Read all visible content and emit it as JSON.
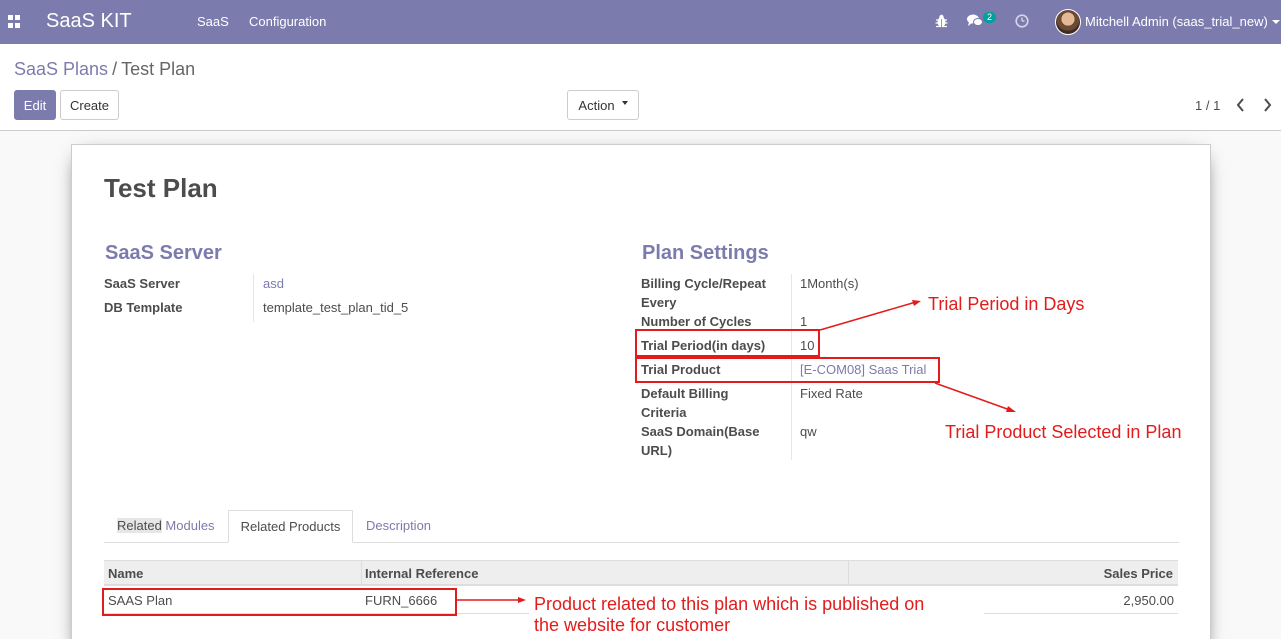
{
  "navbar": {
    "brand": "SaaS KIT",
    "menu": [
      "SaaS",
      "Configuration"
    ],
    "icons": [
      "apps-icon",
      "bug-icon",
      "chat-icon",
      "clock-icon"
    ],
    "message_count": "2",
    "user": "Mitchell Admin (saas_trial_new)"
  },
  "control": {
    "breadcrumb_parent": "SaaS Plans",
    "breadcrumb_sep": "/",
    "breadcrumb_current": "Test Plan",
    "edit_label": "Edit",
    "create_label": "Create",
    "action_label": "Action",
    "pager": "1 / 1"
  },
  "form": {
    "title": "Test Plan",
    "left_group": {
      "title": "SaaS Server",
      "fields": [
        {
          "label": "SaaS Server",
          "value": "asd"
        },
        {
          "label": "DB Template",
          "value": "template_test_plan_tid_5"
        }
      ]
    },
    "right_group": {
      "title": "Plan Settings",
      "fields": [
        {
          "label": "Billing Cycle/Repeat Every",
          "value": "1Month(s)"
        },
        {
          "label": "Number of Cycles",
          "value": "1"
        },
        {
          "label": "Trial Period(in days)",
          "value": "10"
        },
        {
          "label": "Trial Product",
          "value": "[E-COM08] Saas Trial"
        },
        {
          "label": "Default Billing Criteria",
          "value": "Fixed Rate"
        },
        {
          "label": "SaaS Domain(Base URL)",
          "value": "qw"
        }
      ]
    }
  },
  "notebook": {
    "tabs": [
      "Related Modules",
      "Related Products",
      "Description"
    ],
    "tab_highlight": "Related",
    "tab_rest": " Modules",
    "active_tab": "Related Products",
    "columns": [
      "Name",
      "Internal Reference",
      "Sales Price"
    ],
    "rows": [
      {
        "name": "SAAS Plan",
        "ref": "FURN_6666",
        "price": "2,950.00"
      }
    ]
  },
  "annotations": {
    "trial_period": "Trial Period in Days",
    "trial_product": "Trial Product Selected in Plan",
    "product_line1": "Product related to this plan which is published on",
    "product_line2": "the website for customer",
    "color": "#e31b1b"
  },
  "colors": {
    "brand": "#7c7bad",
    "badge": "#00a09d"
  }
}
